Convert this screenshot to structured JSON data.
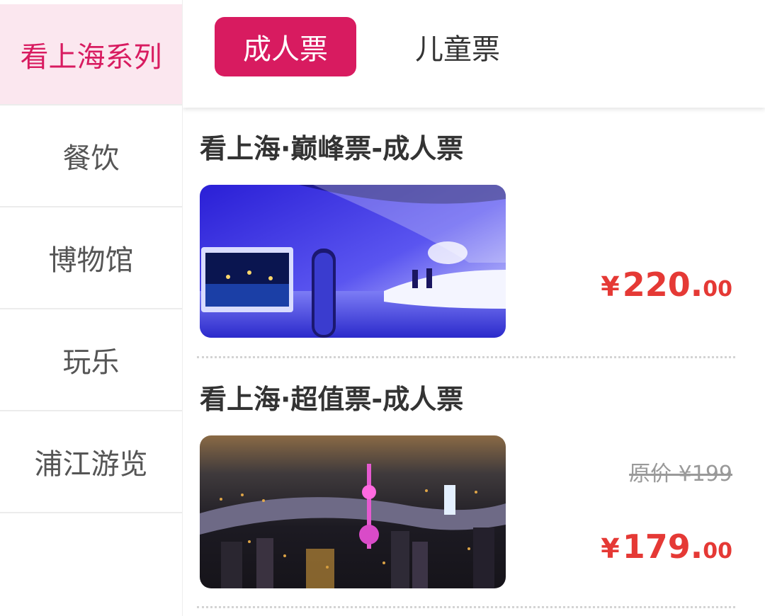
{
  "sidebar": {
    "items": [
      {
        "label": "看上海系列"
      },
      {
        "label": "餐饮"
      },
      {
        "label": "博物馆"
      },
      {
        "label": "玩乐"
      },
      {
        "label": "浦江游览"
      }
    ]
  },
  "tabs": [
    {
      "label": "成人票"
    },
    {
      "label": "儿童票"
    }
  ],
  "products": [
    {
      "title": "看上海·巅峰票-成人票",
      "image": "observation-deck-photo",
      "price": {
        "currency": "¥",
        "integer": "220.",
        "decimal": "00"
      }
    },
    {
      "title": "看上海·超值票-成人票",
      "image": "shanghai-skyline-photo",
      "original_price": "原价 ¥199",
      "price": {
        "currency": "¥",
        "integer": "179.",
        "decimal": "00"
      }
    }
  ],
  "colors": {
    "accent": "#d81b60",
    "price": "#e53935",
    "active_bg": "#fbe7ef"
  }
}
